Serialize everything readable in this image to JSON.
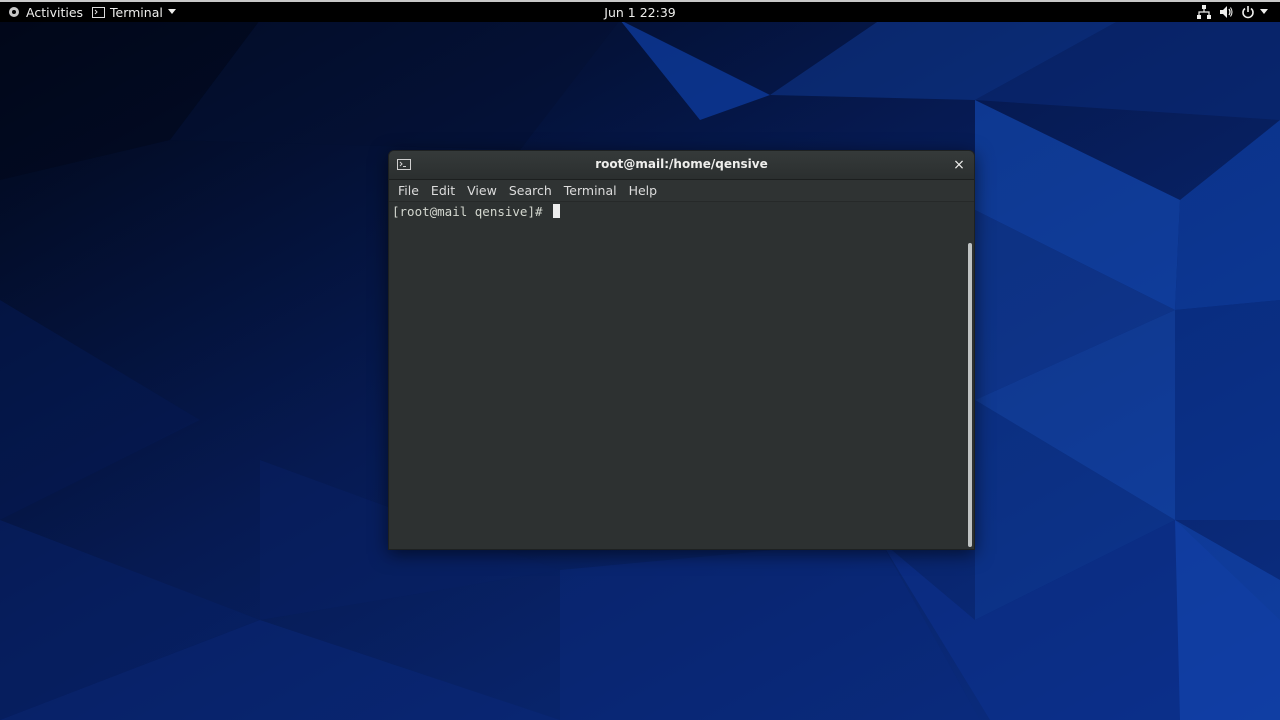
{
  "topbar": {
    "activities_label": "Activities",
    "app_menu_label": "Terminal",
    "clock": "Jun 1  22:39",
    "status_icons": [
      "network-icon",
      "volume-icon",
      "power-icon",
      "chevron-down-icon"
    ]
  },
  "terminal_window": {
    "title": "root@mail:/home/qensive",
    "close_glyph": "×",
    "menu": [
      "File",
      "Edit",
      "View",
      "Search",
      "Terminal",
      "Help"
    ],
    "prompt": "[root@mail qensive]# "
  },
  "colors": {
    "accent": "#1b4fb3",
    "desktop_bg": "#05123f",
    "terminal_bg": "#2d3131"
  }
}
